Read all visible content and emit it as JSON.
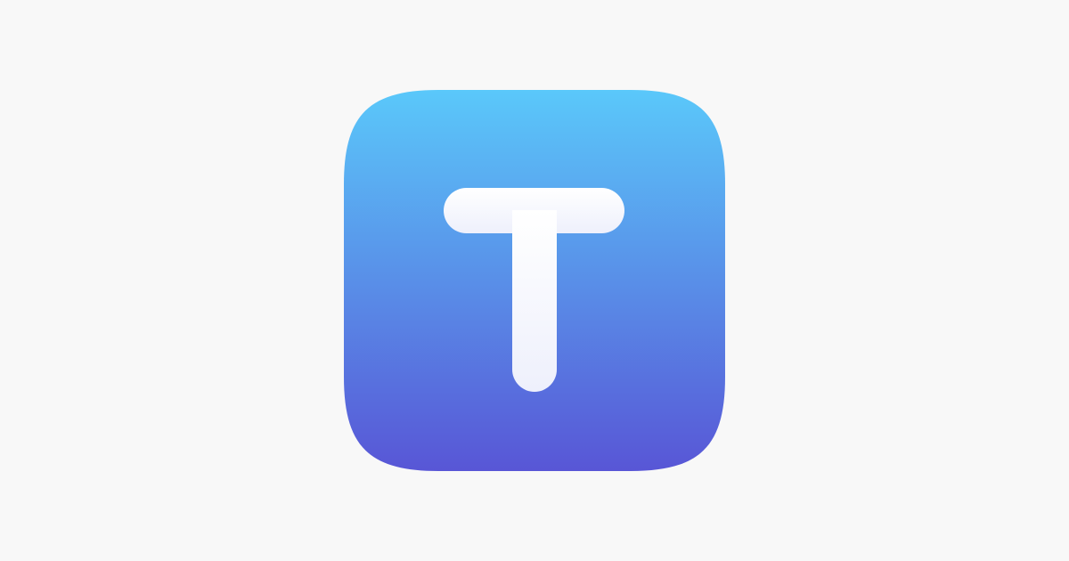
{
  "icon": {
    "name": "T",
    "glyph": "T",
    "gradient_top": "#5ac8fa",
    "gradient_bottom": "#5856d6",
    "glyph_top": "#ffffff",
    "glyph_bottom": "#eef0fc"
  },
  "page": {
    "background": "#f8f8f8"
  }
}
